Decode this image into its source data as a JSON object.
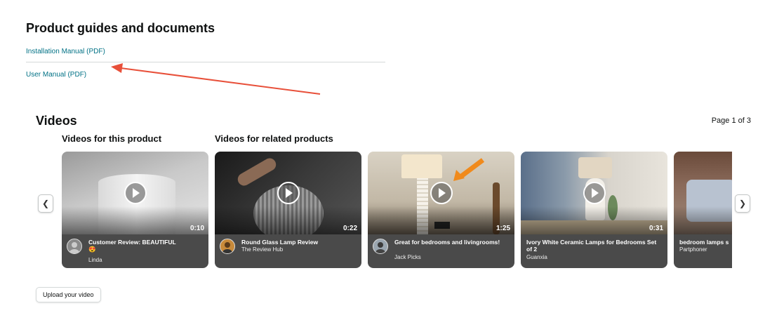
{
  "guides": {
    "title": "Product guides and documents",
    "links": [
      "Installation Manual (PDF)",
      "User Manual (PDF)"
    ]
  },
  "annotation": {
    "arrow_color": "#e8503a"
  },
  "videos": {
    "title": "Videos",
    "page_indicator": "Page 1 of 3",
    "section_this_product": "Videos for this product",
    "section_related": "Videos for related products",
    "prev_icon": "chevron-left-icon",
    "next_icon": "chevron-right-icon",
    "cards": [
      {
        "title": "Customer Review: BEAUTIFUL",
        "emoji": "😍",
        "author": "Linda",
        "duration": "0:10"
      },
      {
        "title": "Round Glass Lamp Review",
        "author": "The Review Hub",
        "duration": "0:22"
      },
      {
        "title": "Great for bedrooms and livingrooms!",
        "author": "Jack Picks",
        "duration": "1:25"
      },
      {
        "title": "Ivory White Ceramic Lamps for Bedrooms Set of 2",
        "author": "Guanxia",
        "duration": "0:31"
      },
      {
        "title": "bedroom lamps s",
        "author": "Partphoner"
      }
    ]
  },
  "upload_label": "Upload your video"
}
